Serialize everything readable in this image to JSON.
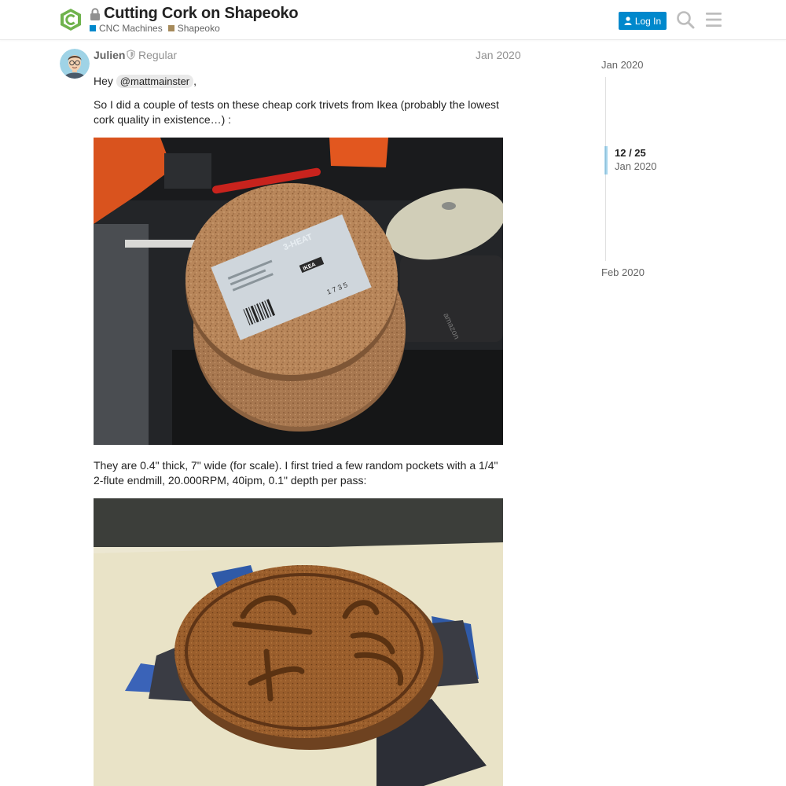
{
  "header": {
    "title": "Cutting Cork on Shapeoko",
    "categories": [
      {
        "label": "CNC Machines",
        "color": "#0088cc"
      },
      {
        "label": "Shapeoko",
        "color": "#a68a5b"
      }
    ],
    "login_label": "Log In",
    "icons": {
      "logo": "site-logo-icon",
      "lock": "lock-icon",
      "search": "search-icon",
      "menu": "hamburger-menu-icon",
      "user": "user-icon"
    }
  },
  "post": {
    "username": "Julien",
    "user_title": "Regular",
    "date": "Jan 2020",
    "hey_prefix": "Hey",
    "mention": "@mattmainster",
    "hey_suffix": ",",
    "paragraph1": "So I did a couple of tests on these cheap cork trivets from Ikea (probably the lowest cork quality in existence…) :",
    "paragraph2": "They are 0.4\" thick, 7\" wide (for scale). I first tried a few random pockets with a 1/4\" 2-flute endmill, 20.000RPM, 40ipm, 0.1\" depth per pass:",
    "photo1_label": {
      "brand": "IKEA",
      "product": "3-HEAT",
      "number": "1 7 3 5"
    },
    "photo1_mousepad_text": "amazon"
  },
  "timeline": {
    "start": "Jan 2020",
    "position": "12 / 25",
    "position_date": "Jan 2020",
    "end": "Feb 2020"
  },
  "colors": {
    "accent": "#0088cc",
    "text": "#222222",
    "muted": "#919191",
    "logo_green": "#6fb34d"
  }
}
